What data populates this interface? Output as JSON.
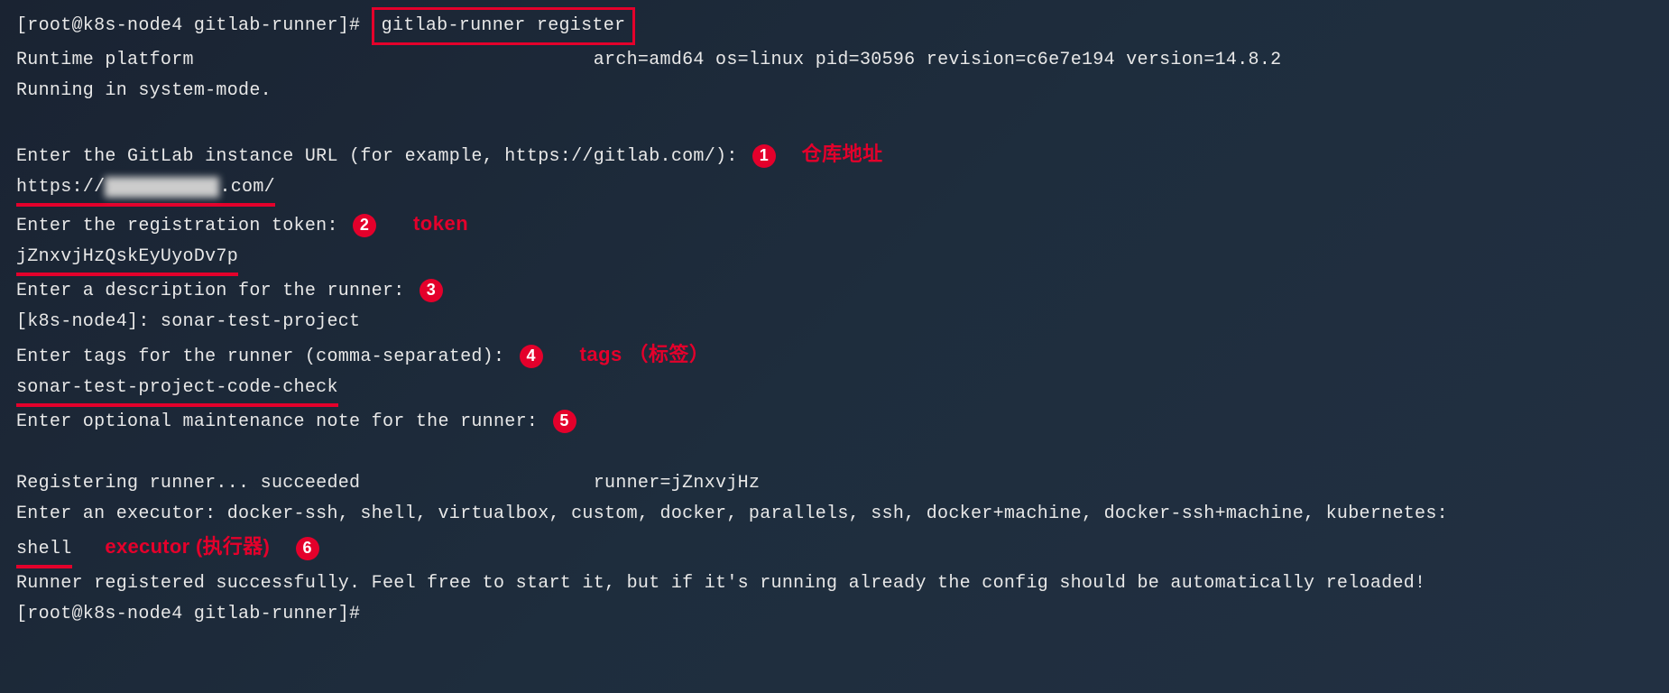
{
  "prompt1": "[root@k8s-node4 gitlab-runner]# ",
  "command": "gitlab-runner register",
  "runtime_label": "Runtime platform",
  "runtime_spacer": "                                    ",
  "runtime_info": "arch=amd64 os=linux pid=30596 revision=c6e7e194 version=14.8.2",
  "running_mode": "Running in system-mode.",
  "step1": {
    "prompt": "Enter the GitLab instance URL (for example, https://gitlab.com/):",
    "badge": "1",
    "label": "仓库地址",
    "url_pre": "https://",
    "url_blur": "g** r****h",
    "url_post": ".com/"
  },
  "step2": {
    "prompt": "Enter the registration token:",
    "badge": "2",
    "label": "token",
    "value": "jZnxvjHzQskEyUyoDv7p"
  },
  "step3": {
    "prompt": "Enter a description for the runner:",
    "badge": "3",
    "value": "[k8s-node4]: sonar-test-project"
  },
  "step4": {
    "prompt": "Enter tags for the runner (comma-separated):",
    "badge": "4",
    "label": "tags （标签）",
    "value": "sonar-test-project-code-check"
  },
  "step5": {
    "prompt": "Enter optional maintenance note for the runner:",
    "badge": "5"
  },
  "registering": {
    "text": "Registering runner... succeeded",
    "spacer": "                     ",
    "runner": "runner=jZnxvjHz"
  },
  "executor_prompt": "Enter an executor: docker-ssh, shell, virtualbox, custom, docker, parallels, ssh, docker+machine, docker-ssh+machine, kubernetes:",
  "step6": {
    "value": "shell",
    "label": "executor (执行器)",
    "badge": "6"
  },
  "success": "Runner registered successfully. Feel free to start it, but if it's running already the config should be automatically reloaded!",
  "prompt2": "[root@k8s-node4 gitlab-runner]#"
}
